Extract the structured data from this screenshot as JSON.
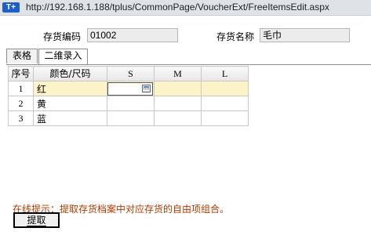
{
  "titlebar": {
    "icon_text": "T+",
    "url": "http://192.168.1.188/tplus/CommonPage/VoucherExt/FreeItemsEdit.aspx"
  },
  "form": {
    "code_label": "存货编码",
    "code_value": "01002",
    "name_label": "存货名称",
    "name_value": "毛巾"
  },
  "tabs": [
    {
      "label": "表格",
      "active": false
    },
    {
      "label": "二维录入",
      "active": true
    }
  ],
  "grid": {
    "headers": {
      "row_no": "序号",
      "attr": "颜色/尺码",
      "sizes": [
        "S",
        "M",
        "L"
      ]
    },
    "rows": [
      {
        "no": "1",
        "name": "红"
      },
      {
        "no": "2",
        "name": "黄"
      },
      {
        "no": "3",
        "name": "蓝"
      }
    ]
  },
  "hint": "在线提示：提取存货档案中对应存货的自由项组合。",
  "actions": {
    "fetch_label": "提取"
  }
}
